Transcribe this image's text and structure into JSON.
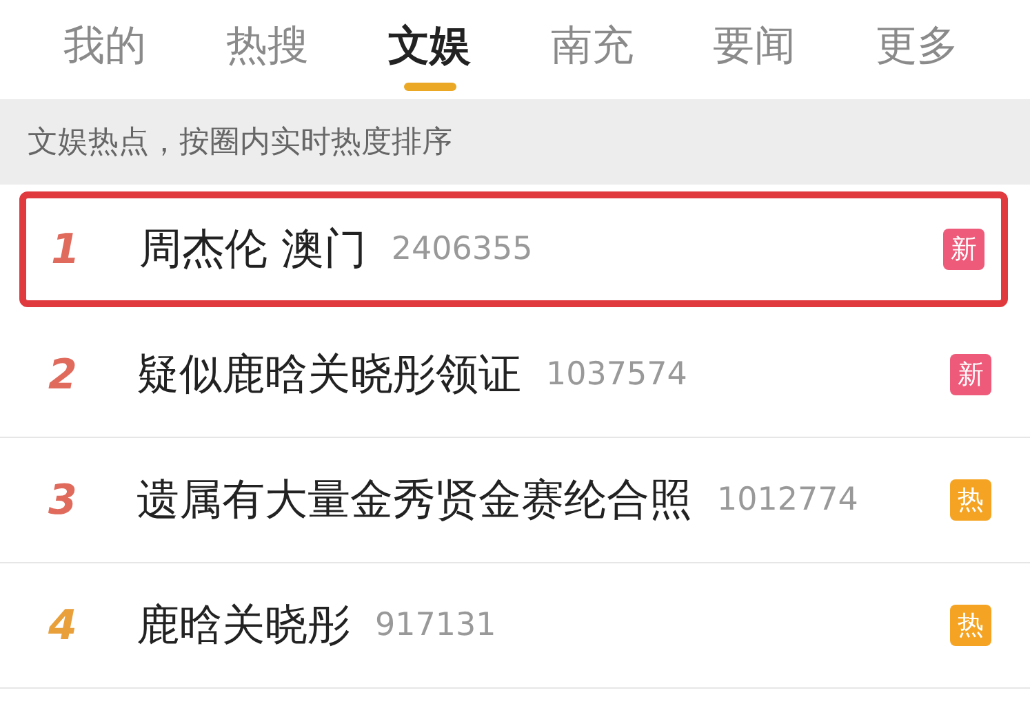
{
  "tabs": [
    {
      "label": "我的",
      "selected": false
    },
    {
      "label": "热搜",
      "selected": false
    },
    {
      "label": "文娱",
      "selected": true
    },
    {
      "label": "南充",
      "selected": false
    },
    {
      "label": "要闻",
      "selected": false
    },
    {
      "label": "更多",
      "selected": false
    }
  ],
  "subtitle": "文娱热点，按圈内实时热度排序",
  "rows": [
    {
      "rank": "1",
      "color": "#e06a5c",
      "title": "周杰伦 澳门",
      "count": "2406355",
      "badge": {
        "kind": "new",
        "label": "新"
      },
      "highlighted": true
    },
    {
      "rank": "2",
      "color": "#e06a5c",
      "title": "疑似鹿晗关晓彤领证",
      "count": "1037574",
      "badge": {
        "kind": "new",
        "label": "新"
      },
      "highlighted": false
    },
    {
      "rank": "3",
      "color": "#e06a5c",
      "title": "遗属有大量金秀贤金赛纶合照",
      "count": "1012774",
      "badge": {
        "kind": "hot",
        "label": "热"
      },
      "highlighted": false
    },
    {
      "rank": "4",
      "color": "#e9a03a",
      "title": "鹿晗关晓彤",
      "count": "917131",
      "badge": {
        "kind": "hot",
        "label": "热"
      },
      "highlighted": false
    }
  ]
}
